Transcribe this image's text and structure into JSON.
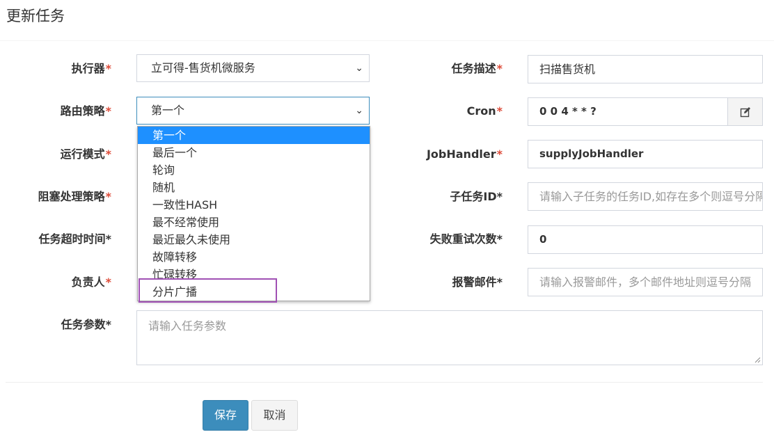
{
  "header": {
    "title": "更新任务"
  },
  "form": {
    "executor": {
      "label": "执行器",
      "req": "*",
      "value": "立可得-售货机微服务"
    },
    "route": {
      "label": "路由策略",
      "req": "*",
      "value": "第一个"
    },
    "run_mode": {
      "label": "运行模式",
      "req": "*"
    },
    "block": {
      "label": "阻塞处理策略",
      "req": "*"
    },
    "timeout": {
      "label": "任务超时时间",
      "req": "*"
    },
    "owner": {
      "label": "负责人",
      "req": "*"
    },
    "params": {
      "label": "任务参数",
      "req": "*",
      "placeholder": "请输入任务参数"
    },
    "desc": {
      "label": "任务描述",
      "req": "*",
      "value": "扫描售货机"
    },
    "cron": {
      "label": "Cron",
      "req": "*",
      "value": "0 0 4 * * ?",
      "icon": "edit-icon"
    },
    "handler": {
      "label": "JobHandler",
      "req": "*",
      "value": "supplyJobHandler"
    },
    "child": {
      "label": "子任务ID",
      "req": "*",
      "placeholder": "请输入子任务的任务ID,如存在多个则逗号分隔"
    },
    "retry": {
      "label": "失败重试次数",
      "req": "*",
      "value": "0"
    },
    "alarm": {
      "label": "报警邮件",
      "req": "*",
      "placeholder": "请输入报警邮件，多个邮件地址则逗号分隔"
    }
  },
  "dropdown": {
    "options": [
      "第一个",
      "最后一个",
      "轮询",
      "随机",
      "一致性HASH",
      "最不经常使用",
      "最近最久未使用",
      "故障转移",
      "忙碌转移",
      "分片广播"
    ],
    "selected_index": 0,
    "highlighted_option": "分片广播"
  },
  "buttons": {
    "save": "保存",
    "cancel": "取消"
  },
  "colors": {
    "primary": "#3c8dbc",
    "required": "#dd4b39",
    "selected_option": "#1e90ff",
    "highlight_box": "#a050b4"
  }
}
